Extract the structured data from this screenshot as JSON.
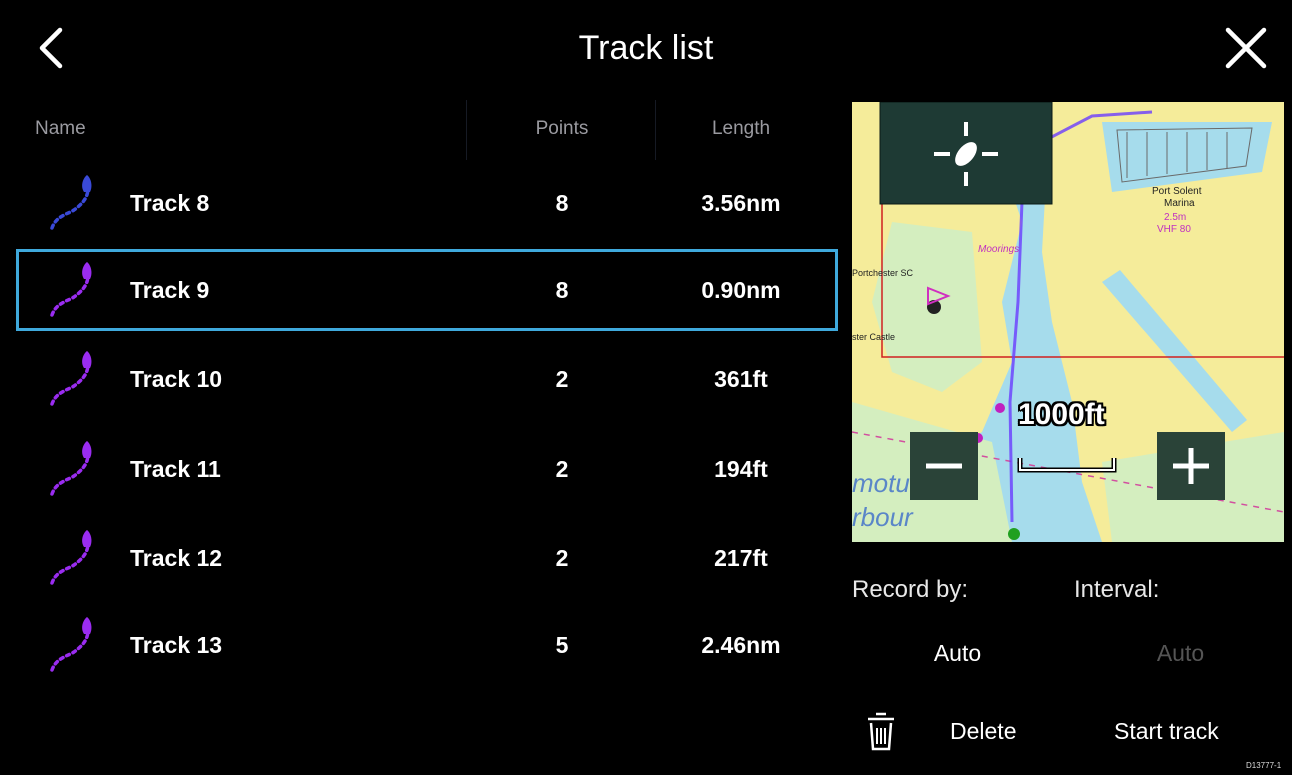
{
  "header": {
    "title": "Track list"
  },
  "columns": {
    "name": "Name",
    "points": "Points",
    "length": "Length"
  },
  "tracks": [
    {
      "name": "Track 8",
      "points": "8",
      "length": "3.56nm",
      "icon_color": "#3a4ad8"
    },
    {
      "name": "Track 9",
      "points": "8",
      "length": "0.90nm",
      "icon_color": "#9a2cf0",
      "selected": true
    },
    {
      "name": "Track 10",
      "points": "2",
      "length": "361ft",
      "icon_color": "#9a2cf0"
    },
    {
      "name": "Track 11",
      "points": "2",
      "length": "194ft",
      "icon_color": "#9a2cf0"
    },
    {
      "name": "Track 12",
      "points": "2",
      "length": "217ft",
      "icon_color": "#9a2cf0"
    },
    {
      "name": "Track 13",
      "points": "5",
      "length": "2.46nm",
      "icon_color": "#9a2cf0"
    }
  ],
  "map": {
    "scale": "1000ft",
    "labels": [
      "Port Solent",
      "Marina",
      "2.5m",
      "VHF 80",
      "Portchester SC",
      "ster Castle",
      "Moorings",
      "motuh",
      "rbour"
    ]
  },
  "settings": {
    "record_by_label": "Record by:",
    "record_by_value": "Auto",
    "interval_label": "Interval:",
    "interval_value": "Auto"
  },
  "actions": {
    "delete": "Delete",
    "start_track": "Start track"
  },
  "doc_id": "D13777-1",
  "colors": {
    "selection": "#3fa9dc",
    "accent": "#9a2cf0",
    "map_land": "#f5ec9a",
    "map_water": "#a6dcec"
  },
  "icons": {
    "back": "chevron-left-icon",
    "close": "close-icon",
    "track": "track-icon",
    "trash": "trash-icon"
  }
}
